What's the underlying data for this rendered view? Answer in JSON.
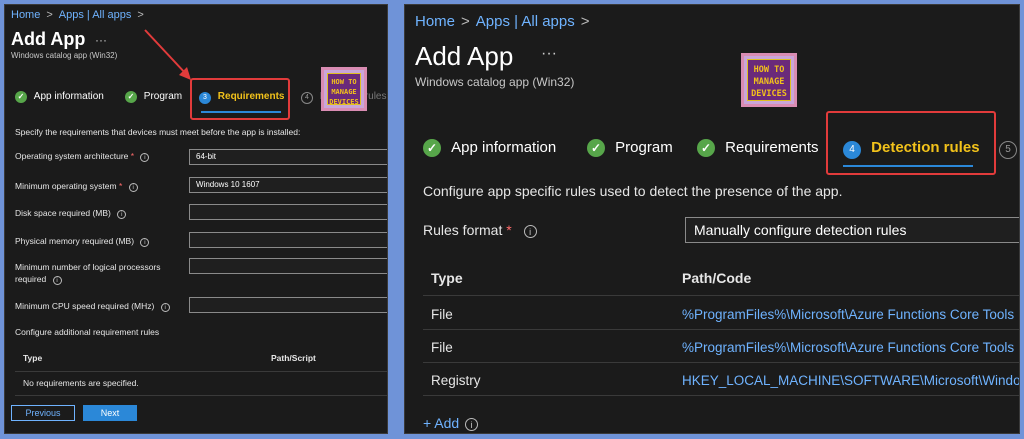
{
  "left": {
    "breadcrumb": [
      "Home",
      "Apps | All apps"
    ],
    "title": "Add App",
    "more": "···",
    "subtitle": "Windows catalog app (Win32)",
    "steps": [
      {
        "label": "App information",
        "state": "done"
      },
      {
        "label": "Program",
        "state": "done"
      },
      {
        "label": "Requirements",
        "num": "3",
        "state": "active"
      },
      {
        "label": "Detection rules",
        "num": "4",
        "state": "pending"
      }
    ],
    "intro": "Specify the requirements that devices must meet before the app is installed:",
    "fields": [
      {
        "label": "Operating system architecture",
        "required": true,
        "value": "64-bit"
      },
      {
        "label": "Minimum operating system",
        "required": true,
        "value": "Windows 10 1607"
      },
      {
        "label": "Disk space required (MB)",
        "value": ""
      },
      {
        "label": "Physical memory required (MB)",
        "value": ""
      },
      {
        "label_line1": "Minimum number of logical processors",
        "label_line2": "required",
        "value": ""
      },
      {
        "label": "Minimum CPU speed required (MHz)",
        "value": ""
      }
    ],
    "additional": "Configure additional requirement rules",
    "table": {
      "type": "Type",
      "path": "Path/Script",
      "empty": "No requirements are specified."
    },
    "buttons": {
      "previous": "Previous",
      "next": "Next"
    }
  },
  "right": {
    "breadcrumb": [
      "Home",
      "Apps | All apps"
    ],
    "title": "Add App",
    "more": "···",
    "subtitle": "Windows catalog app (Win32)",
    "steps": [
      {
        "label": "App information",
        "state": "done"
      },
      {
        "label": "Program",
        "state": "done"
      },
      {
        "label": "Requirements",
        "state": "done"
      },
      {
        "label": "Detection rules",
        "num": "4",
        "state": "active"
      },
      {
        "num": "5",
        "state": "pending"
      }
    ],
    "description": "Configure app specific rules used to detect the presence of the app.",
    "rules_format": {
      "label": "Rules format",
      "value": "Manually configure detection rules"
    },
    "table": {
      "headers": [
        "Type",
        "Path/Code"
      ],
      "rows": [
        {
          "type": "File",
          "path": "%ProgramFiles%\\Microsoft\\Azure Functions Core Tools"
        },
        {
          "type": "File",
          "path": "%ProgramFiles%\\Microsoft\\Azure Functions Core Tools"
        },
        {
          "type": "Registry",
          "path": "HKEY_LOCAL_MACHINE\\SOFTWARE\\Microsoft\\Windows"
        }
      ]
    },
    "add": "+ Add"
  },
  "logo": {
    "line1": "HOW TO",
    "line2": "MANAGE",
    "line3": "DEVICES"
  },
  "colors": {
    "highlight": "#e23b3b",
    "accent": "#2b88d8",
    "link": "#6fb3ff",
    "check": "#57a64a",
    "active_tab": "#f2c21b",
    "background": "#6f93d8"
  }
}
